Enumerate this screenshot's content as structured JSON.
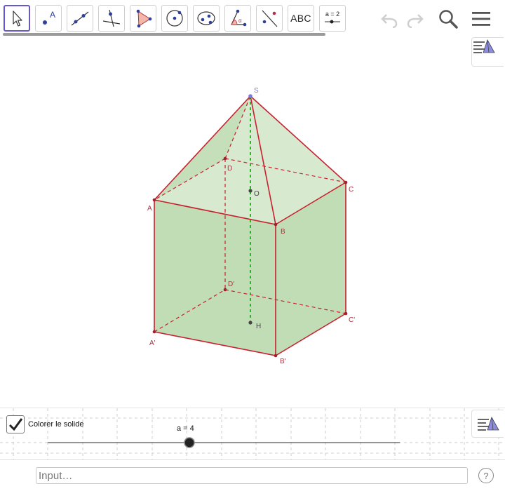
{
  "toolbar": {
    "abc_label": "ABC",
    "slider_tool_label": "a = 2"
  },
  "construction": {
    "points": {
      "S": "S",
      "A": "A",
      "B": "B",
      "C": "C",
      "D": "D",
      "O": "O",
      "A_prime": "A'",
      "B_prime": "B'",
      "C_prime": "C'",
      "D_prime": "D'",
      "H": "H"
    }
  },
  "panel2": {
    "checkbox_label": "Colorer le solide",
    "checkbox_checked": true,
    "slider_label": "a = 4",
    "slider_value": 4
  },
  "inputbar": {
    "placeholder": "Input…",
    "help": "?"
  },
  "colors": {
    "accent": "#6557d2",
    "edge": "#c8202e",
    "fill": "#a6cf95",
    "height_line": "#22aa22"
  }
}
